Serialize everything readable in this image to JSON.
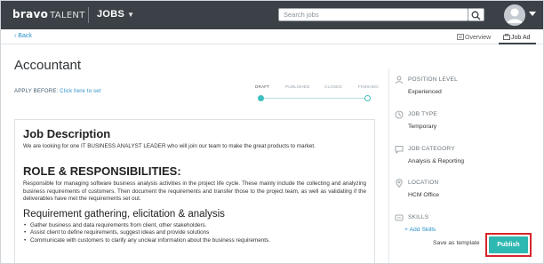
{
  "header": {
    "logo_brand": "bravo",
    "logo_suffix": "TALENT",
    "module": "JOBS",
    "search_placeholder": "Search jobs"
  },
  "subbar": {
    "back_label": "Back",
    "tabs": [
      {
        "label": "Overview",
        "icon": "document-icon"
      },
      {
        "label": "Job Ad",
        "icon": "briefcase-icon",
        "active": true
      }
    ]
  },
  "job": {
    "title": "Accountant",
    "apply_before_label": "APPLY BEFORE:",
    "apply_before_link": "Click here to set",
    "status_steps": [
      {
        "label": "DRAFT",
        "active": true
      },
      {
        "label": "PUBLISHED",
        "active": false
      },
      {
        "label": "CLOSED",
        "active": false
      },
      {
        "label": "FINISHED",
        "active": false
      }
    ]
  },
  "content": {
    "job_description_heading": "Job Description",
    "job_description_text": "We are looking for one IT BUSINESS ANALYST LEADER who will join our team to make the great products to market.",
    "role_heading": "ROLE & RESPONSIBILITIES:",
    "role_text": "Responsible for managing software business analysis activities in the project life cycle. These mainly include the collecting and analyzing business requirements of customers. Then document the requirements and transfer those to the project team, as well as validating if the deliverables have met the requirements set out.",
    "requirement_heading": "Requirement gathering, elicitation & analysis",
    "requirement_items": [
      "Gather business and data requirements from client, other stakeholders.",
      "Assist client to define requirements, suggest ideas and provide solutions",
      "Communicate with customers to clarify any unclear information about the business requirements."
    ]
  },
  "sidebar": {
    "items": [
      {
        "label": "POSITION LEVEL",
        "value": "Experienced",
        "icon": "person-level-icon"
      },
      {
        "label": "JOB TYPE",
        "value": "Temporary",
        "icon": "clock-icon"
      },
      {
        "label": "JOB CATEGORY",
        "value": "Analysis & Reporting",
        "icon": "chat-bubble-icon"
      },
      {
        "label": "LOCATION",
        "value": "HCM Office",
        "icon": "location-pin-icon"
      },
      {
        "label": "SKILLS",
        "value": "",
        "icon": "skills-icon"
      }
    ],
    "add_skills": "+ Add Skills",
    "save_template": "Save as template",
    "publish": "Publish"
  },
  "colors": {
    "topbar": "#3b4147",
    "accent": "#2fb8b2",
    "link": "#2a8fc9",
    "highlight": "#d6252a"
  }
}
